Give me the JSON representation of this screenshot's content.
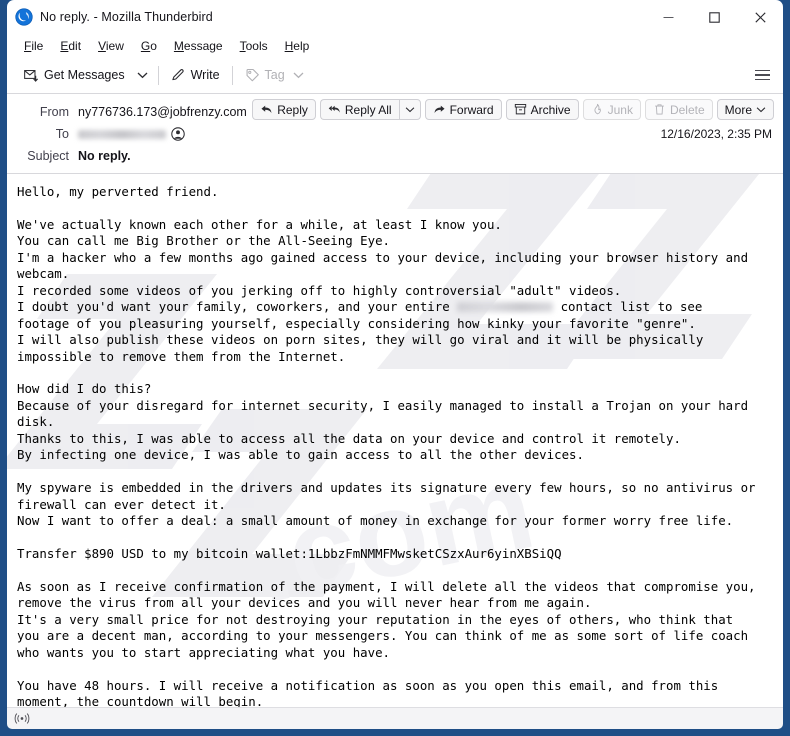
{
  "window": {
    "title": "No reply. - Mozilla Thunderbird",
    "logo_icon": "thunderbird-logo-icon",
    "controls": {
      "minimize": "minimize-icon",
      "maximize": "maximize-icon",
      "close": "close-icon"
    }
  },
  "menu_bar": {
    "items": [
      {
        "label": "File",
        "mnemonic": "F",
        "rest": "ile"
      },
      {
        "label": "Edit",
        "mnemonic": "E",
        "rest": "dit"
      },
      {
        "label": "View",
        "mnemonic": "V",
        "rest": "iew"
      },
      {
        "label": "Go",
        "mnemonic": "G",
        "rest": "o"
      },
      {
        "label": "Message",
        "mnemonic": "M",
        "rest": "essage"
      },
      {
        "label": "Tools",
        "mnemonic": "T",
        "rest": "ools"
      },
      {
        "label": "Help",
        "mnemonic": "H",
        "rest": "elp"
      }
    ]
  },
  "toolbar": {
    "get_messages_label": "Get Messages",
    "get_messages_icon": "get-mail-icon",
    "get_messages_caret": "chevron-down-icon",
    "write_label": "Write",
    "write_icon": "pencil-icon",
    "tag_label": "Tag",
    "tag_icon": "tag-icon",
    "tag_caret": "chevron-down-icon",
    "tag_disabled": true,
    "hamburger_icon": "hamburger-menu-icon"
  },
  "message_header": {
    "from_label": "From",
    "from_value": "ny776736.173@jobfrenzy.com",
    "from_avatar_icon": "contact-avatar-icon",
    "to_label": "To",
    "to_value": "",
    "to_redacted": true,
    "to_avatar_icon": "contact-avatar-icon",
    "subject_label": "Subject",
    "subject_value": "No reply.",
    "date": "12/16/2023, 2:35 PM"
  },
  "actions": [
    {
      "label": "Reply",
      "icon": "reply-icon",
      "disabled": false,
      "split": false
    },
    {
      "label": "Reply All",
      "icon": "reply-all-icon",
      "disabled": false,
      "split": true,
      "caret": "chevron-down-icon"
    },
    {
      "label": "Forward",
      "icon": "forward-icon",
      "disabled": false,
      "split": false
    },
    {
      "label": "Archive",
      "icon": "archive-box-icon",
      "disabled": false,
      "split": false
    },
    {
      "label": "Junk",
      "icon": "junk-flame-icon",
      "disabled": true,
      "split": false
    },
    {
      "label": "Delete",
      "icon": "trash-icon",
      "disabled": true,
      "split": false
    },
    {
      "label": "More",
      "icon": "chevron-down-icon",
      "disabled": false,
      "split": false,
      "icon_after": true
    }
  ],
  "body": {
    "part1": "Hello, my perverted friend.\n\nWe've actually known each other for a while, at least I know you.\nYou can call me Big Brother or the All-Seeing Eye.\nI'm a hacker who a few months ago gained access to your device, including your browser history and\nwebcam.\nI recorded some videos of you jerking off to highly controversial \"adult\" videos.\nI doubt you'd want your family, coworkers, and your entire ",
    "part2": " contact list to see\nfootage of you pleasuring yourself, especially considering how kinky your favorite \"genre\".\nI will also publish these videos on porn sites, they will go viral and it will be physically\nimpossible to remove them from the Internet.\n\nHow did I do this?\nBecause of your disregard for internet security, I easily managed to install a Trojan on your hard\ndisk.\nThanks to this, I was able to access all the data on your device and control it remotely.\nBy infecting one device, I was able to gain access to all the other devices.\n\nMy spyware is embedded in the drivers and updates its signature every few hours, so no antivirus or\nfirewall can ever detect it.\nNow I want to offer a deal: a small amount of money in exchange for your former worry free life.\n\nTransfer $890 USD to my bitcoin wallet:1LbbzFmNMMFMwsketCSzxAur6yinXBSiQQ\n\nAs soon as I receive confirmation of the payment, I will delete all the videos that compromise you,\nremove the virus from all your devices and you will never hear from me again.\nIt's a very small price for not destroying your reputation in the eyes of others, who think that\nyou are a decent man, according to your messengers. You can think of me as some sort of life coach\nwho wants you to start appreciating what you have.\n\nYou have 48 hours. I will receive a notification as soon as you open this email, and from this\nmoment, the countdown will begin.",
    "ransom_amount": "$890 USD",
    "bitcoin_wallet": "1LbbzFmNMMFMwsketCSzxAur6yinXBSiQQ",
    "deadline_hours": "48 hours"
  },
  "status_bar": {
    "connection_icon": "connection-signal-icon"
  },
  "colors": {
    "window_frame": "#1f4e86",
    "background": "#ffffff",
    "text": "#15141a",
    "muted_text": "#42414d",
    "disabled_text": "#b3b3b8",
    "border": "#d8d8dc",
    "status_bar": "#f4f4f6"
  }
}
